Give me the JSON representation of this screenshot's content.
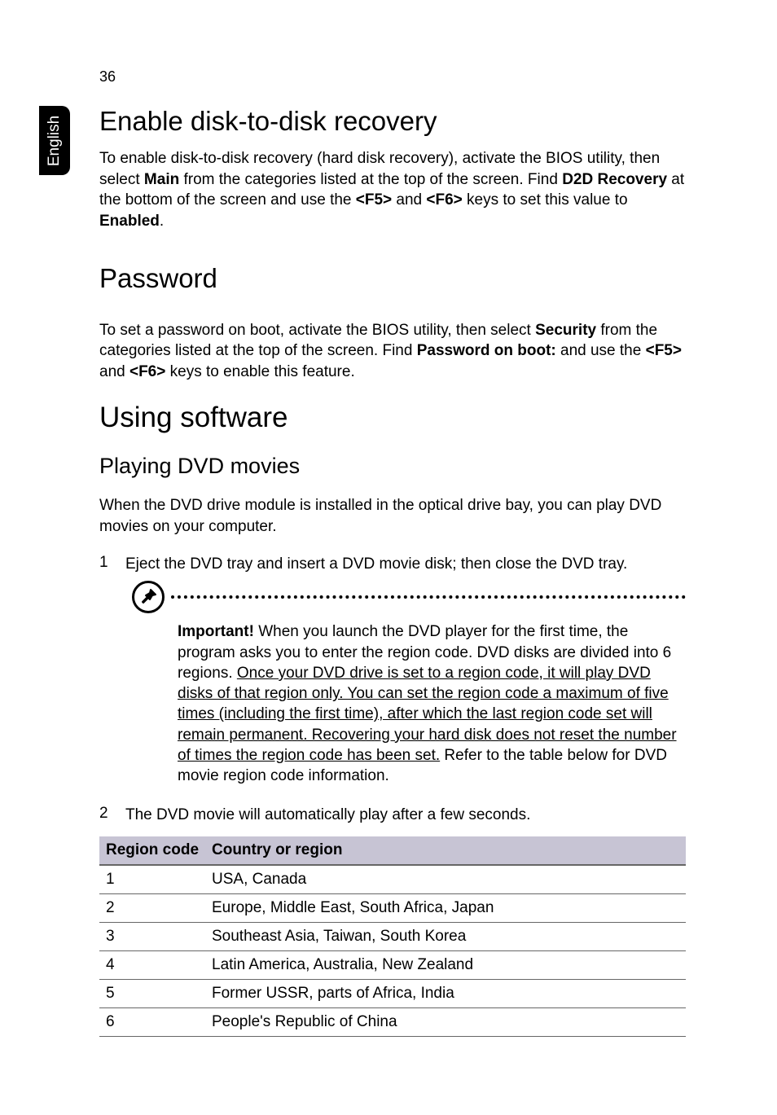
{
  "page_number": "36",
  "side_tab": "English",
  "sections": {
    "enable_recovery": {
      "heading": "Enable disk-to-disk recovery",
      "para_parts": {
        "t1": "To enable disk-to-disk recovery (hard disk recovery), activate the BIOS utility, then select ",
        "b1": "Main",
        "t2": " from the categories listed at the top of the screen. Find ",
        "b2": "D2D Recovery",
        "t3": " at the bottom of the screen and use the ",
        "b3": "<F5>",
        "t4": " and ",
        "b4": "<F6>",
        "t5": " keys to set this value to ",
        "b5": "Enabled",
        "t6": "."
      }
    },
    "password": {
      "heading": "Password",
      "para_parts": {
        "t1": "To set a password on boot, activate the BIOS utility, then select ",
        "b1": "Security",
        "t2": " from the categories listed at the top of the screen. Find ",
        "b2": "Password on boot:",
        "t3": " and use the ",
        "b3": "<F5>",
        "t4": " and ",
        "b4": "<F6>",
        "t5": " keys to enable this feature."
      }
    },
    "software": {
      "heading": "Using software",
      "sub_heading": "Playing DVD movies",
      "intro": "When the DVD drive module is installed in the optical drive bay, you can play DVD movies on your computer.",
      "step1_num": "1",
      "step1_text": "Eject the DVD tray and insert a DVD movie disk; then close the DVD tray.",
      "note": {
        "b1": "Important!",
        "t1": " When you launch the DVD player for the first time, the program asks you to enter the region code. DVD disks are divided into 6 regions. ",
        "u1": "Once your DVD drive is set to a region code, it will play DVD disks of that region only. You can set the region code a maximum of five times (including the first time), after which the last region code set will remain permanent. Recovering your hard disk does not reset the number of times the region code has been set.",
        "t2": " Refer to the table below for DVD movie region code information."
      },
      "step2_num": "2",
      "step2_text": "The DVD movie will automatically play after a few seconds.",
      "table": {
        "head_code": "Region code",
        "head_region": "Country or region",
        "rows": [
          {
            "code": "1",
            "region": "USA, Canada"
          },
          {
            "code": "2",
            "region": "Europe, Middle East, South Africa, Japan"
          },
          {
            "code": "3",
            "region": "Southeast Asia, Taiwan, South Korea"
          },
          {
            "code": "4",
            "region": "Latin America, Australia, New Zealand"
          },
          {
            "code": "5",
            "region": "Former USSR, parts of Africa, India"
          },
          {
            "code": "6",
            "region": "People's Republic of China"
          }
        ]
      }
    }
  }
}
